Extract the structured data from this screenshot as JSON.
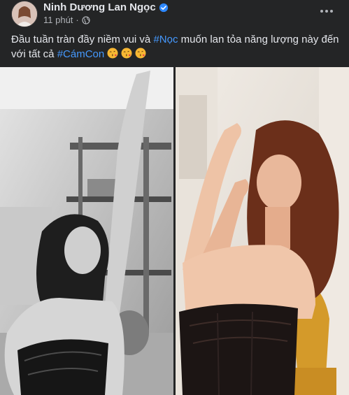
{
  "post": {
    "author": "Ninh Dương Lan Ngọc",
    "time": "11 phút",
    "separator": "·",
    "caption": {
      "text_before": "Đầu tuần tràn đầy niềm vui và ",
      "hashtag1": "#Nọc",
      "text_middle": " muốn lan tỏa năng lượng này đến với tất cả ",
      "hashtag2": "#CámCon"
    },
    "emojis": [
      "kiss-heart-emoji",
      "kiss-heart-emoji",
      "kiss-heart-emoji"
    ],
    "photos": [
      "left-photo-bw",
      "right-photo-color"
    ]
  },
  "colors": {
    "background": "#242526",
    "text": "#e4e6eb",
    "secondary_text": "#b0b3b8",
    "hashtag": "#4599ff",
    "verified": "#2d88ff"
  }
}
